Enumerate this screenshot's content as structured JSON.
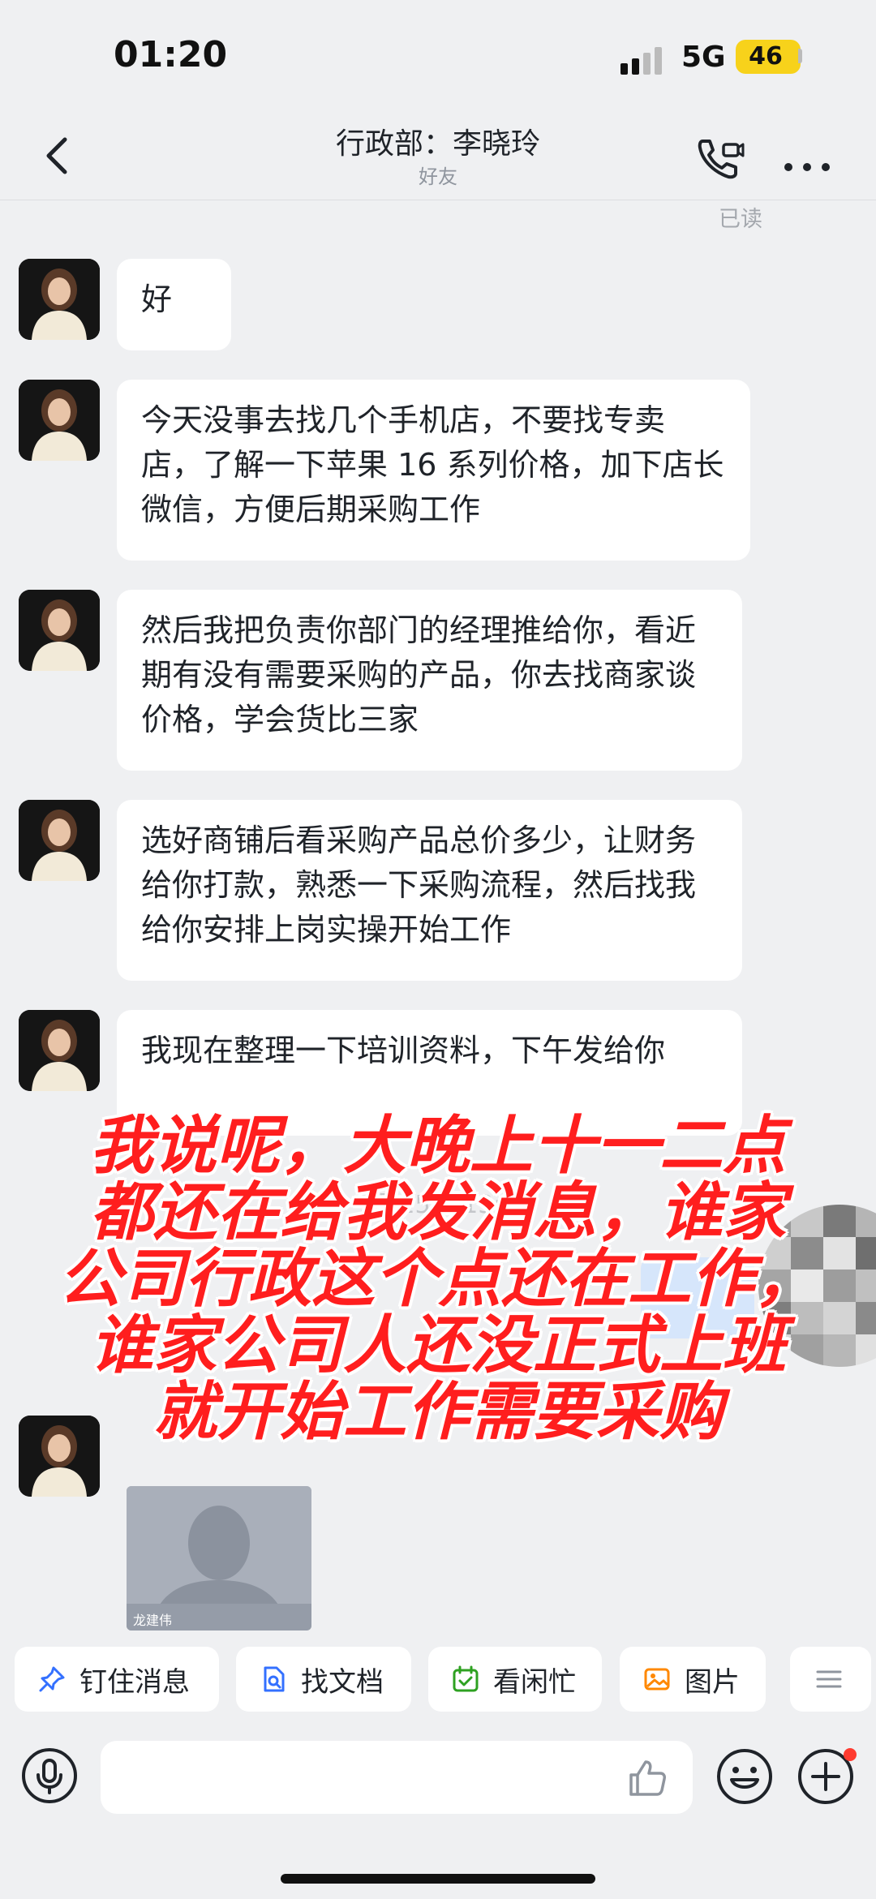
{
  "status": {
    "time": "01:20",
    "network": "5G",
    "battery": "46"
  },
  "header": {
    "title": "行政部：李晓玲",
    "subtitle": "好友",
    "read_label": "已读"
  },
  "messages": [
    {
      "text": "好"
    },
    {
      "text": "今天没事去找几个手机店，不要找专卖店，了解一下苹果 16 系列价格，加下店长微信，方便后期采购工作"
    },
    {
      "text": "然后我把负责你部门的经理推给你，看近期有没有需要采购的产品，你去找商家谈价格，学会货比三家"
    },
    {
      "text": "选好商铺后看采购产品总价多少，让财务给你打款，熟悉一下采购流程，然后找我给你安排上岗实操开始工作"
    },
    {
      "text": "我现在整理一下培训资料，下午发给你"
    }
  ],
  "blurred_time": "5月25日 13:10",
  "overlay_caption": [
    "我说呢，大晚上十一二点",
    "都还在给我发消息，谁家",
    "公司行政这个点还在工作，",
    "谁家公司人还没正式上班",
    "就开始工作需要采购"
  ],
  "contact_card": {
    "name": "龙建伟"
  },
  "quick_actions": [
    {
      "label": "钉住消息",
      "icon": "pin-icon"
    },
    {
      "label": "找文档",
      "icon": "find-doc-icon"
    },
    {
      "label": "看闲忙",
      "icon": "calendar-icon"
    },
    {
      "label": "图片",
      "icon": "image-icon"
    }
  ],
  "colors": {
    "overlay_text": "#ff1e1e",
    "background": "#eff0f2",
    "battery": "#f7d21b",
    "accent_blue": "#3370ff",
    "accent_green": "#2ea121",
    "accent_orange": "#ff8800"
  }
}
